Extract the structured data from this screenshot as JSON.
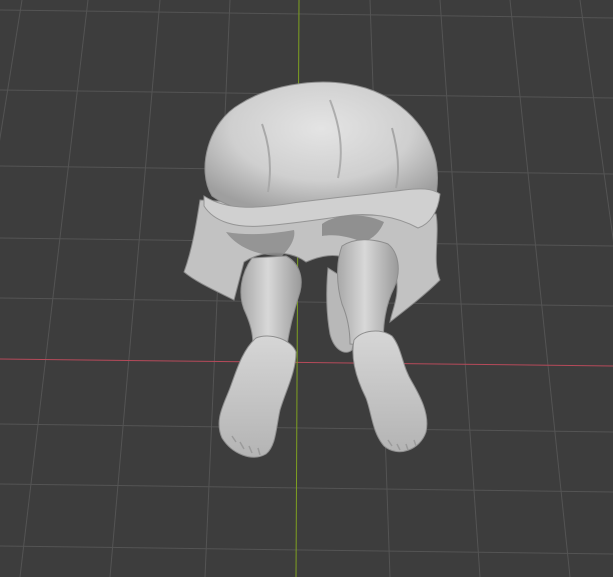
{
  "viewport": {
    "background": "#3d3d3d",
    "grid_color": "#545454",
    "x_axis_color": "#b64a5a",
    "y_axis_color": "#7ea021",
    "grid_visible": true,
    "model": {
      "name": "sculpted-mesh",
      "description_icon": "sculpt-mesh-icon",
      "base_color": "#c9c9c9",
      "shadow_color": "#8c8c8c",
      "highlight_color": "#e6e6e6"
    }
  }
}
